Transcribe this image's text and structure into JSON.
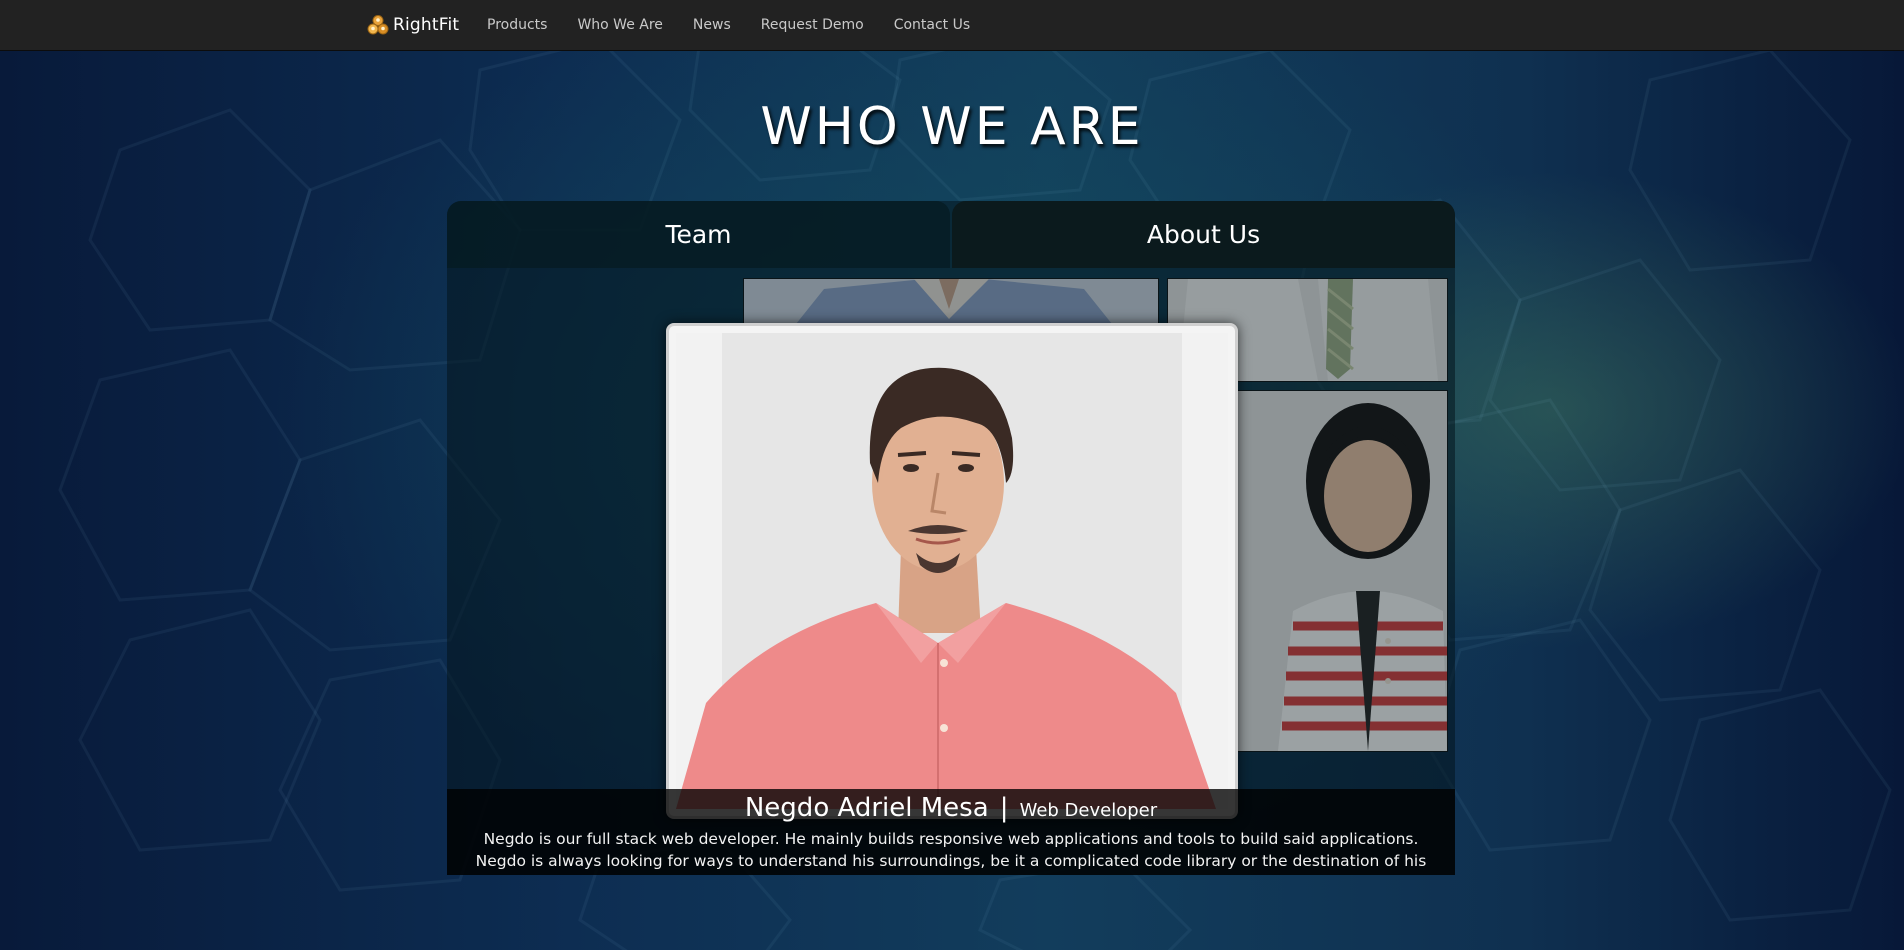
{
  "brand": {
    "name": "RightFit"
  },
  "nav": {
    "items": [
      {
        "label": "Products"
      },
      {
        "label": "Who We Are"
      },
      {
        "label": "News"
      },
      {
        "label": "Request Demo"
      },
      {
        "label": "Contact Us"
      }
    ]
  },
  "page": {
    "title": "WHO WE ARE"
  },
  "tabs": [
    {
      "label": "Team",
      "active": true
    },
    {
      "label": "About Us",
      "active": false
    }
  ],
  "featured": {
    "name": "Negdo Adriel Mesa",
    "separator": "|",
    "role": "Web Developer",
    "bio": "Negdo is our full stack web developer. He mainly builds responsive web applications and tools to build said applications. Negdo is always looking for ways to understand his surroundings, be it a complicated code library or the destination of his lost pens."
  },
  "colors": {
    "navbar": "#222222",
    "nav_text": "#c9c9c9",
    "brand_icon": "#e8a23a",
    "featured_shirt": "#ee8a8a"
  }
}
